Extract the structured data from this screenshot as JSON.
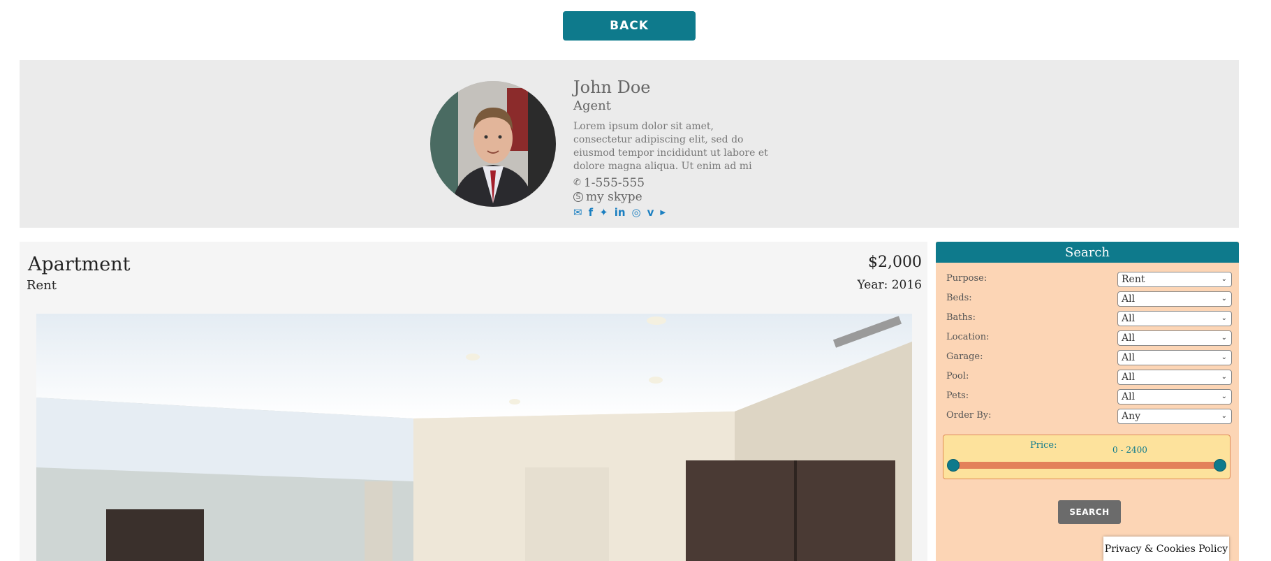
{
  "nav": {
    "back_label": "BACK"
  },
  "agent": {
    "name": "John Doe",
    "role": "Agent",
    "bio": "Lorem ipsum dolor sit amet, consectetur adipiscing elit, sed do eiusmod tempor incididunt ut labore et dolore magna aliqua. Ut enim ad mi",
    "phone": "1-555-555",
    "skype": "my skype",
    "social_icons": [
      "envelope-icon",
      "facebook-icon",
      "twitter-icon",
      "linkedin-icon",
      "instagram-icon",
      "vimeo-icon",
      "youtube-icon"
    ]
  },
  "listing": {
    "title": "Apartment",
    "purpose": "Rent",
    "price": "$2,000",
    "year": "Year: 2016"
  },
  "search": {
    "title": "Search",
    "fields": [
      {
        "label": "Purpose:",
        "value": "Rent"
      },
      {
        "label": "Beds:",
        "value": "All"
      },
      {
        "label": "Baths:",
        "value": "All"
      },
      {
        "label": "Location:",
        "value": "All"
      },
      {
        "label": "Garage:",
        "value": "All"
      },
      {
        "label": "Pool:",
        "value": "All"
      },
      {
        "label": "Pets:",
        "value": "All"
      },
      {
        "label": "Order By:",
        "value": "Any"
      }
    ],
    "price_label": "Price:",
    "price_range": "0 - 2400",
    "price_min_fraction": 0,
    "price_max_fraction": 1,
    "button_label": "SEARCH"
  },
  "footer": {
    "privacy_label": "Privacy & Cookies Policy"
  },
  "colors": {
    "accent": "#0e7a8c",
    "search_bg": "#fcd5b5",
    "social": "#1a7fc1"
  }
}
